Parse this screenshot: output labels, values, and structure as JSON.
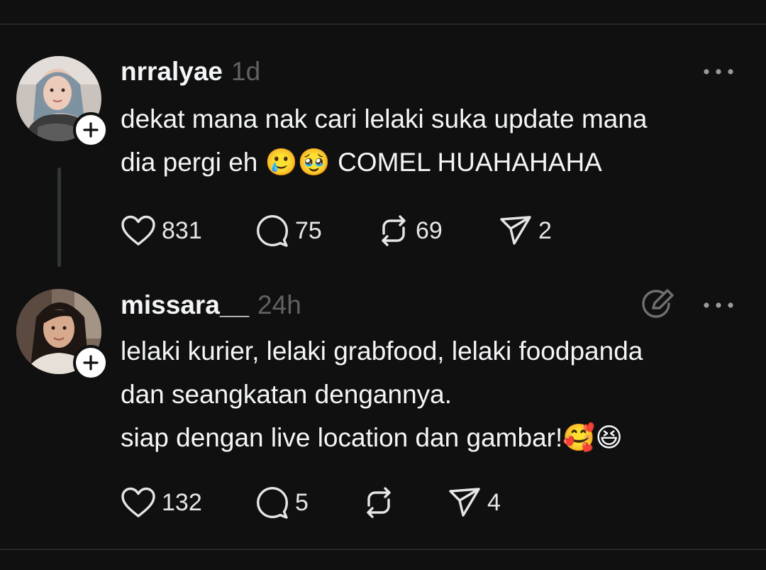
{
  "posts": [
    {
      "username": "nrralyae",
      "time": "1d",
      "lines": [
        "dekat mana nak cari lelaki suka update mana",
        "dia pergi eh 🥲🥹 COMEL HUAHAHAHA"
      ],
      "likes": "831",
      "replies": "75",
      "reposts": "69",
      "shares": "2"
    },
    {
      "username": "missara__",
      "time": "24h",
      "lines": [
        "lelaki kurier, lelaki grabfood, lelaki foodpanda",
        "dan seangkatan dengannya.",
        "siap dengan live location dan gambar!🥰😆"
      ],
      "likes": "132",
      "replies": "5",
      "reposts": "",
      "shares": "4"
    }
  ],
  "icons": {
    "like": "heart-icon",
    "reply": "comment-icon",
    "repost": "repost-icon",
    "share": "send-icon",
    "more": "more-dots-icon",
    "follow": "plus-icon",
    "edit": "edit-icon"
  },
  "colors": {
    "background": "#101010",
    "text": "#f3f5f7",
    "muted": "#616161",
    "divider": "#262626"
  }
}
